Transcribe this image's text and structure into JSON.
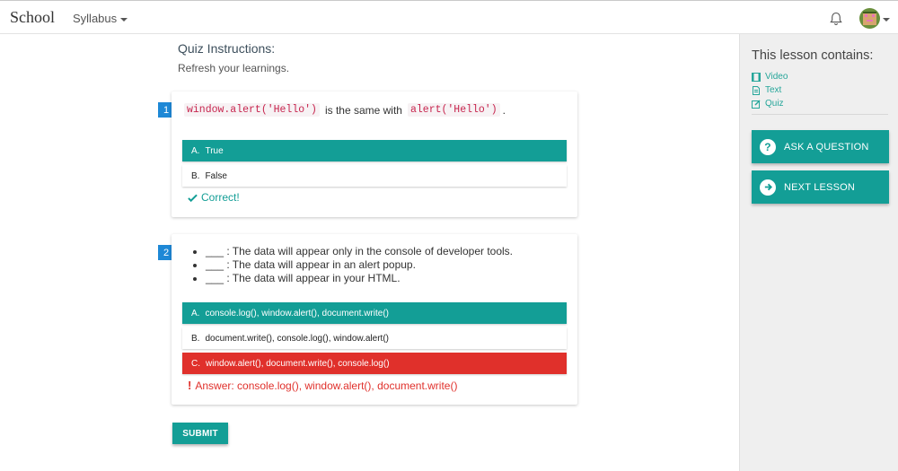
{
  "nav": {
    "brand": "School",
    "syllabus": "Syllabus"
  },
  "quiz": {
    "title": "Quiz Instructions:",
    "subtitle": "Refresh your learnings."
  },
  "questions": [
    {
      "number": "1",
      "code_a": "window.alert('Hello')",
      "mid_text": "is the same with",
      "code_b": "alert('Hello')",
      "end": ".",
      "options": [
        {
          "letter": "A.",
          "text": "True",
          "state": "selected-correct"
        },
        {
          "letter": "B.",
          "text": "False",
          "state": "normal"
        }
      ],
      "feedback": "Correct!"
    },
    {
      "number": "2",
      "bullets": [
        "___ : The data will appear only in the console of developer tools.",
        "___ : The data will appear in an alert popup.",
        "___ : The data will appear in your HTML."
      ],
      "options": [
        {
          "letter": "A.",
          "text": "console.log(), window.alert(), document.write()",
          "state": "selected-correct"
        },
        {
          "letter": "B.",
          "text": "document.write(), console.log(), window.alert()",
          "state": "normal"
        },
        {
          "letter": "C.",
          "text": "window.alert(), document.write(), console.log()",
          "state": "wrong"
        }
      ],
      "feedback": "Answer: console.log(), window.alert(), document.write()"
    }
  ],
  "submit_label": "SUBMIT",
  "sidebar": {
    "title": "This lesson contains:",
    "items": [
      {
        "icon": "film-icon",
        "label": "Video"
      },
      {
        "icon": "document-icon",
        "label": "Text"
      },
      {
        "icon": "edit-icon",
        "label": "Quiz"
      }
    ],
    "ask_label": "ASK A QUESTION",
    "next_label": "NEXT LESSON"
  },
  "colors": {
    "teal": "#139e96",
    "red": "#e0302b",
    "blue_badge": "#1e88d6"
  }
}
